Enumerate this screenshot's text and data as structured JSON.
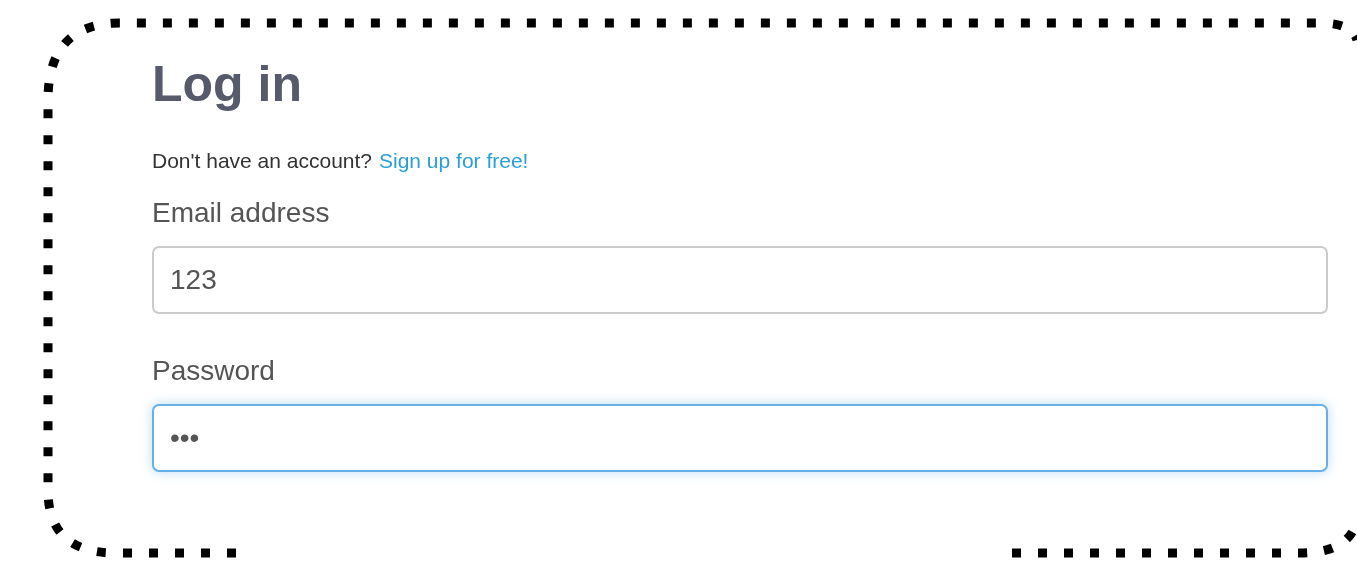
{
  "title": "Log in",
  "signup": {
    "text": "Don't have an account?",
    "link": "Sign up for free!"
  },
  "fields": [
    {
      "label": "Email address",
      "value": "123",
      "focused": false
    },
    {
      "label": "Password",
      "value": "•••",
      "focused": true
    }
  ]
}
